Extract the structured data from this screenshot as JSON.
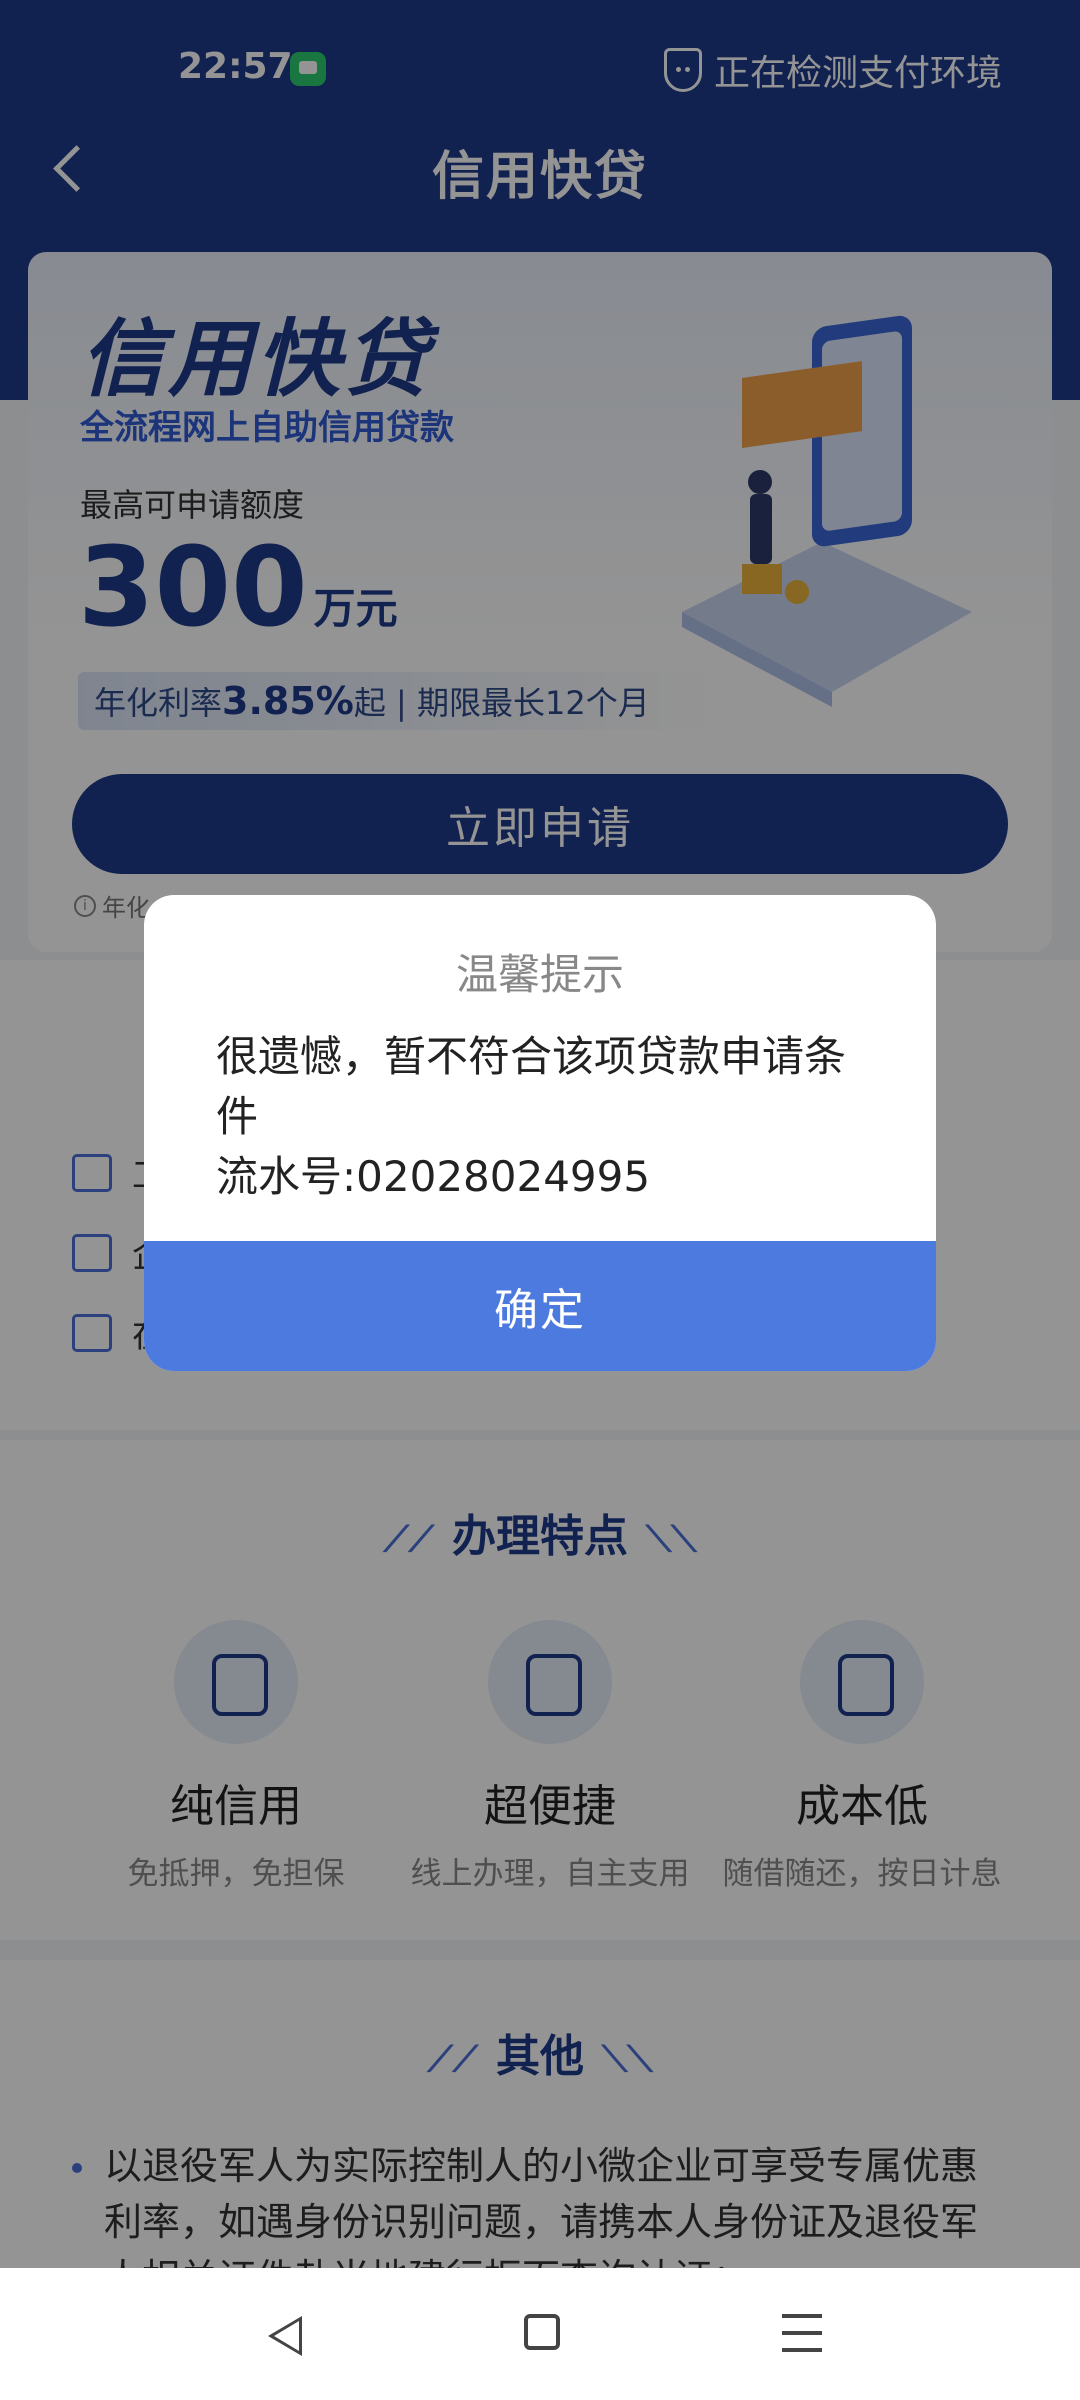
{
  "status": {
    "time": "22:57",
    "right_text": "正在检测支付环境"
  },
  "header": {
    "title": "信用快贷"
  },
  "hero": {
    "title": "信用快贷",
    "subtitle": "全流程网上自助信用贷款",
    "limit_label": "最高可申请额度",
    "amount": "300",
    "amount_unit": "万元",
    "rate_prefix": "年化利率",
    "rate_value": "3.85%",
    "rate_suffix": "起 | 期限最长12个月",
    "apply_button": "立即申请",
    "note": "年化"
  },
  "conditions": [
    {
      "text": "工"
    },
    {
      "text": "企"
    },
    {
      "text": "在"
    }
  ],
  "features": {
    "title": "办理特点",
    "items": [
      {
        "name": "纯信用",
        "desc": "免抵押，免担保"
      },
      {
        "name": "超便捷",
        "desc": "线上办理，自主支用"
      },
      {
        "name": "成本低",
        "desc": "随借随还，按日计息"
      }
    ]
  },
  "other": {
    "title": "其他",
    "text": "以退役军人为实际控制人的小微企业可享受专属优惠利率，如遇身份识别问题，请携本人身份证及退役军人相关证件赴当地建行柜面查询认证；"
  },
  "dialog": {
    "title": "温馨提示",
    "message_line1": "很遗憾，暂不符合该项贷款申请条件",
    "serial_label": "流水号:",
    "serial_number": "02028024995",
    "ok_button": "确定"
  },
  "colors": {
    "brand": "#1e3a8a",
    "dialog_button": "#4d7ade"
  }
}
